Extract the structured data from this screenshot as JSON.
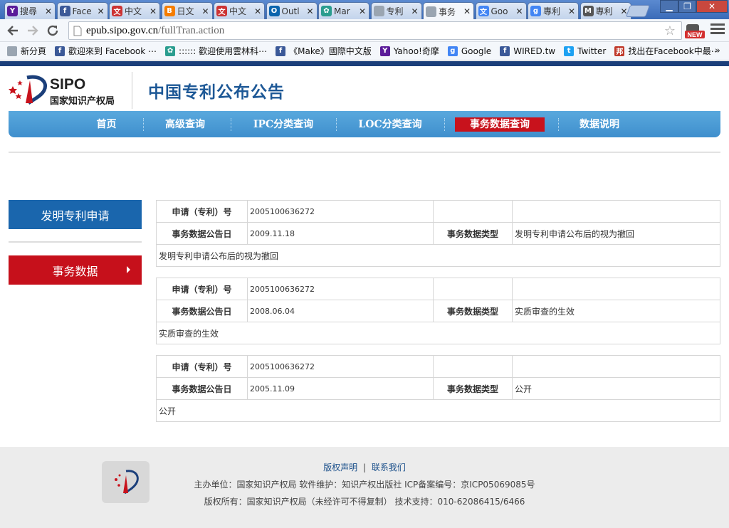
{
  "browser": {
    "tabs": [
      {
        "icon": "yahoo-icon",
        "color": "#5a1b99",
        "glyph": "Y",
        "title": "搜尋"
      },
      {
        "icon": "facebook-icon",
        "color": "#3b5998",
        "glyph": "f",
        "title": "Face"
      },
      {
        "icon": "patent-icon",
        "color": "#cc3333",
        "glyph": "文",
        "title": "中文"
      },
      {
        "icon": "blogger-icon",
        "color": "#f57d00",
        "glyph": "B",
        "title": "日文"
      },
      {
        "icon": "patent-icon",
        "color": "#cc3333",
        "glyph": "文",
        "title": "中文"
      },
      {
        "icon": "outlook-icon",
        "color": "#0a64ad",
        "glyph": "O",
        "title": "Outl"
      },
      {
        "icon": "maps-icon",
        "color": "#2a9d8f",
        "glyph": "✿",
        "title": "Mar"
      },
      {
        "icon": "page-icon",
        "color": "#9aa5b1",
        "glyph": "",
        "title": "专利"
      },
      {
        "icon": "page-icon",
        "color": "#9aa5b1",
        "glyph": "",
        "title": "事务"
      },
      {
        "icon": "translate-icon",
        "color": "#4285f4",
        "glyph": "文",
        "title": "Goo"
      },
      {
        "icon": "google-icon",
        "color": "#4285f4",
        "glyph": "g",
        "title": "專利"
      },
      {
        "icon": "m-icon",
        "color": "#555555",
        "glyph": "M",
        "title": "專利"
      }
    ],
    "active_tab": 8,
    "url_host": "epub.sipo.gov.cn",
    "url_path": "/fullTran.action",
    "bookmarks": [
      {
        "icon": "page-icon",
        "color": "#9aa5b1",
        "glyph": "",
        "label": "新分頁"
      },
      {
        "icon": "facebook-icon",
        "color": "#3b5998",
        "glyph": "f",
        "label": "歡迎來到 Facebook ⋯"
      },
      {
        "icon": "flower-icon",
        "color": "#2a9d8f",
        "glyph": "✿",
        "label": ":::::: 歡迎使用雲林科⋯"
      },
      {
        "icon": "facebook-icon",
        "color": "#3b5998",
        "glyph": "f",
        "label": "《Make》國際中文版"
      },
      {
        "icon": "yahoo-icon",
        "color": "#5a1b99",
        "glyph": "Y",
        "label": "Yahoo!奇摩"
      },
      {
        "icon": "google-icon",
        "color": "#4285f4",
        "glyph": "g",
        "label": "Google"
      },
      {
        "icon": "facebook-icon",
        "color": "#3b5998",
        "glyph": "f",
        "label": "WIRED.tw"
      },
      {
        "icon": "twitter-icon",
        "color": "#1da1f2",
        "glyph": "t",
        "label": "Twitter"
      },
      {
        "icon": "search-icon",
        "color": "#c0392b",
        "glyph": "邦",
        "label": "找出在Facebook中最⋯"
      }
    ],
    "bookmarks_more": "»",
    "new_badge": "NEW"
  },
  "site": {
    "logo_text": "SIPO",
    "logo_cn": "国家知识产权局",
    "title": "中国专利公布公告",
    "nav": [
      "首页",
      "高级查询",
      "IPC分类查询",
      "LOC分类查询",
      "事务数据查询",
      "数据说明"
    ],
    "nav_active": 4
  },
  "sidebar": {
    "invention": "发明专利申请",
    "data": "事务数据"
  },
  "labels": {
    "app_no": "申请（专利）号",
    "pub_date": "事务数据公告日",
    "type": "事务数据类型"
  },
  "records": [
    {
      "app_no": "2005100636272",
      "pub_date": "2009.11.18",
      "type": "发明专利申请公布后的视为撤回",
      "detail": "发明专利申请公布后的视为撤回"
    },
    {
      "app_no": "2005100636272",
      "pub_date": "2008.06.04",
      "type": "实质审查的生效",
      "detail": "实质审查的生效"
    },
    {
      "app_no": "2005100636272",
      "pub_date": "2005.11.09",
      "type": "公开",
      "detail": "公开"
    }
  ],
  "footer": {
    "copyright_link": "版权声明",
    "separator": "|",
    "contact_link": "联系我们",
    "line2": "主办单位：国家知识产权局 软件维护：知识产权出版社 ICP备案编号：京ICP05069085号",
    "line3": "版权所有：国家知识产权局（未经许可不得复制） 技术支持：010-62086415/6466"
  }
}
